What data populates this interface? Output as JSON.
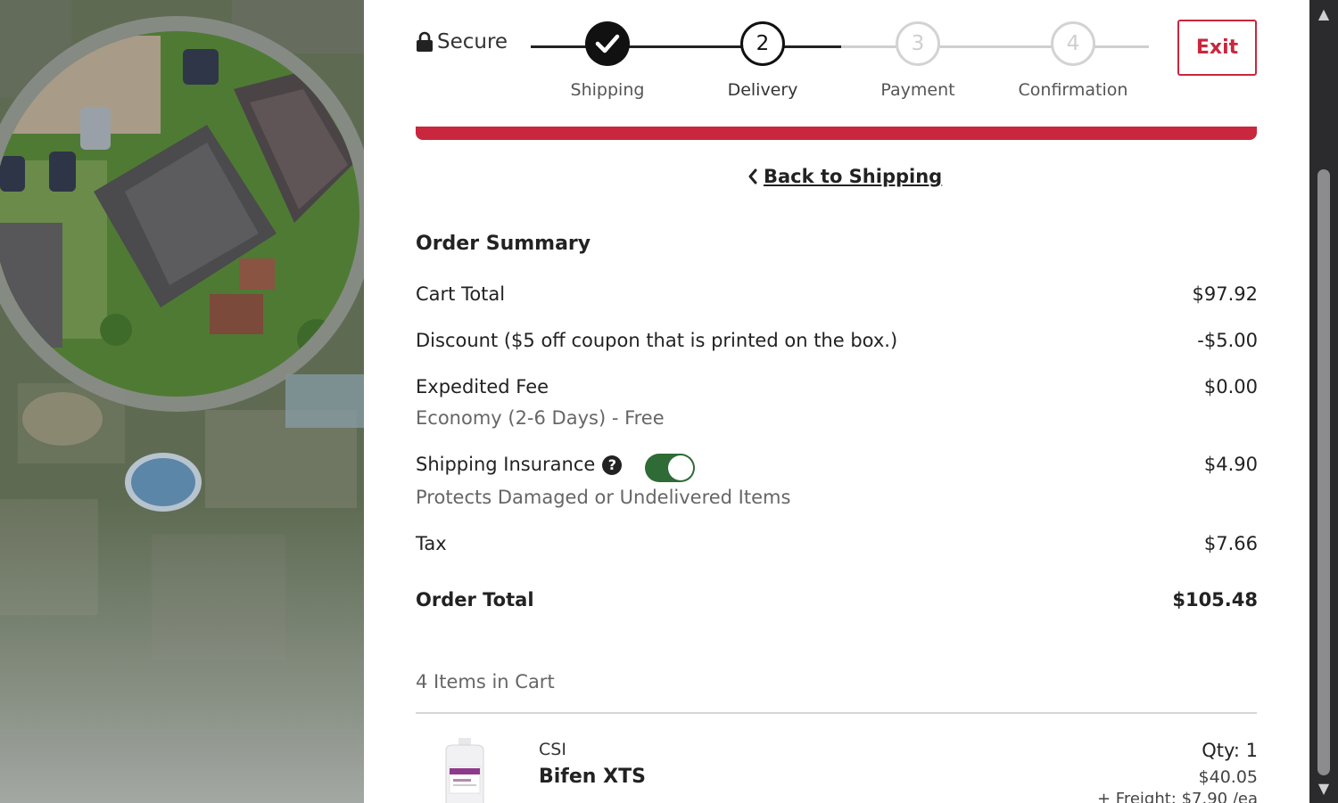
{
  "header": {
    "secure_label": "Secure",
    "exit_label": "Exit",
    "steps": [
      {
        "number": "",
        "label": "Shipping",
        "state": "complete"
      },
      {
        "number": "2",
        "label": "Delivery",
        "state": "current"
      },
      {
        "number": "3",
        "label": "Payment",
        "state": "upcoming"
      },
      {
        "number": "4",
        "label": "Confirmation",
        "state": "upcoming"
      }
    ],
    "accent_color": "#c8273d"
  },
  "back_link": {
    "label": "Back to Shipping",
    "icon": "chevron-left-icon"
  },
  "order_summary": {
    "title": "Order Summary",
    "cart_total": {
      "label": "Cart Total",
      "value": "$97.92"
    },
    "discount": {
      "label": "Discount ($5 off coupon that is printed on the box.)",
      "value": "-$5.00"
    },
    "expedited_fee": {
      "label": "Expedited Fee",
      "value": "$0.00",
      "sub": "Economy (2-6 Days) - Free"
    },
    "shipping_insurance": {
      "label": "Shipping Insurance",
      "value": "$4.90",
      "sub": "Protects Damaged or Undelivered Items",
      "enabled": true,
      "toggle_color": "#2e6b36"
    },
    "tax": {
      "label": "Tax",
      "value": "$7.66"
    },
    "order_total": {
      "label": "Order Total",
      "value": "$105.48"
    }
  },
  "cart": {
    "items_count_label": "4 Items in Cart",
    "items": [
      {
        "brand": "CSI",
        "name": "Bifen XTS",
        "qty": "Qty: 1",
        "price": "$40.05",
        "freight": "+ Freight: $7.90 /ea"
      }
    ]
  }
}
